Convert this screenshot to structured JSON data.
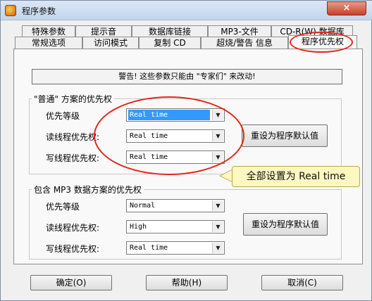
{
  "window": {
    "title": "程序参数",
    "close_label": "×"
  },
  "tabs_row1": [
    "特殊参数",
    "提示音",
    "数据库链接",
    "MP3-文件",
    "CD-R(W) 数据库"
  ],
  "tabs_row2": [
    "常规选项",
    "访问模式",
    "复制 CD",
    "超烧/警告 信息",
    "程序优先权"
  ],
  "warning": "警告! 这些参数只能由 \"专家们\" 来改动!",
  "normal_group": {
    "title": "\"普通\" 方案的优先权",
    "fields": [
      {
        "label": "优先等级",
        "value": "Real time"
      },
      {
        "label": "读线程优先权:",
        "value": "Real time"
      },
      {
        "label": "写线程优先权:",
        "value": "Real time"
      }
    ],
    "reset_label": "重设为程序默认值"
  },
  "mp3_group": {
    "title": "包含 MP3 数据方案的优先权",
    "fields": [
      {
        "label": "优先等级",
        "value": "Normal"
      },
      {
        "label": "读线程优先权:",
        "value": "High"
      },
      {
        "label": "写线程优先权:",
        "value": "Real time"
      }
    ],
    "reset_label": "重设为程序默认值"
  },
  "buttons": {
    "ok": "确定(O)",
    "help": "帮助(H)",
    "cancel": "取消(C)"
  },
  "annotation": {
    "text": "全部设置为 Real time",
    "color": "#e3261b"
  }
}
